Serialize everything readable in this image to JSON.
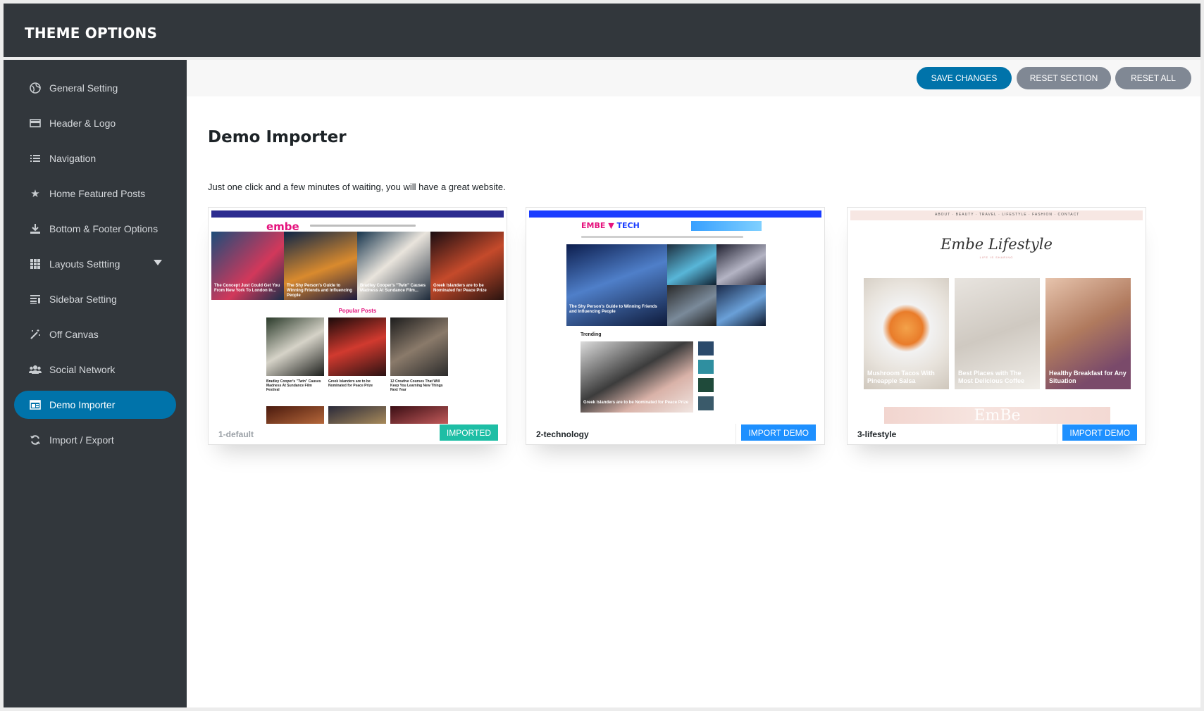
{
  "header": {
    "title": "THEME OPTIONS"
  },
  "sidebar": {
    "items": [
      {
        "label": "General Setting",
        "icon": "globe-icon"
      },
      {
        "label": "Header & Logo",
        "icon": "header-card-icon"
      },
      {
        "label": "Navigation",
        "icon": "list-icon"
      },
      {
        "label": "Home Featured Posts",
        "icon": "star-icon"
      },
      {
        "label": "Bottom & Footer Options",
        "icon": "download-icon"
      },
      {
        "label": "Layouts Settting",
        "icon": "grid-icon"
      },
      {
        "label": "Sidebar Setting",
        "icon": "sidebar-icon"
      },
      {
        "label": "Off Canvas",
        "icon": "magic-wand-icon"
      },
      {
        "label": "Social Network",
        "icon": "users-icon"
      },
      {
        "label": "Demo Importer",
        "icon": "window-icon"
      },
      {
        "label": "Import / Export",
        "icon": "refresh-icon"
      }
    ],
    "active_index": 9
  },
  "toolbar": {
    "save_label": "SAVE CHANGES",
    "reset_section_label": "RESET SECTION",
    "reset_all_label": "RESET ALL"
  },
  "page": {
    "title": "Demo Importer",
    "description": "Just one click and a few minutes of waiting, you will have a great website."
  },
  "demos": [
    {
      "name": "1-default",
      "button_label": "IMPORTED",
      "status": "imported",
      "preview": {
        "logo": "embe",
        "section_heading": "Popular Posts",
        "hero_captions": [
          "The Concept Just Could Get You From New York To London in...",
          "The Shy Person's Guide to Winning Friends and Influencing People",
          "Bradley Cooper's \"Twin\" Causes Madness At Sundance Film...",
          "Greek Islanders are to be Nominated for Peace Prize"
        ],
        "post_captions": [
          "Bradley Cooper's \"Twin\" Causes Madness At Sundance Film Festival",
          "Greek Islanders are to be Nominated for Peace Prize",
          "12 Creative Courses That Will Keep You Learning New Things Next Year"
        ]
      }
    },
    {
      "name": "2-technology",
      "button_label": "IMPORT DEMO",
      "status": "available",
      "preview": {
        "logo_left": "EMBE",
        "logo_right": "TECH",
        "section_heading": "Trending",
        "hero_caption": "The Shy Person's Guide to Winning Friends and Influencing People",
        "main_caption": "Greek Islanders are to be Nominated for Peace Prize"
      }
    },
    {
      "name": "3-lifestyle",
      "button_label": "IMPORT DEMO",
      "status": "available",
      "preview": {
        "logo": "Embe Lifestyle",
        "tagline": "LIFE IS SHARING",
        "nav": [
          "ABOUT",
          "BEAUTY",
          "TRAVEL",
          "LIFESTYLE",
          "FASHION",
          "CONTACT"
        ],
        "captions": [
          "Mushroom Tacos With Pineapple Salsa",
          "Best Places with The Most Delicious Coffee",
          "Healthy Breakfast for Any Situation"
        ],
        "banner": "EmBe"
      }
    }
  ],
  "colors": {
    "header_bg": "#32373c",
    "accent": "#0073aa",
    "imported": "#1ebea5",
    "import": "#1e90ff",
    "secondary_button": "#808894"
  }
}
